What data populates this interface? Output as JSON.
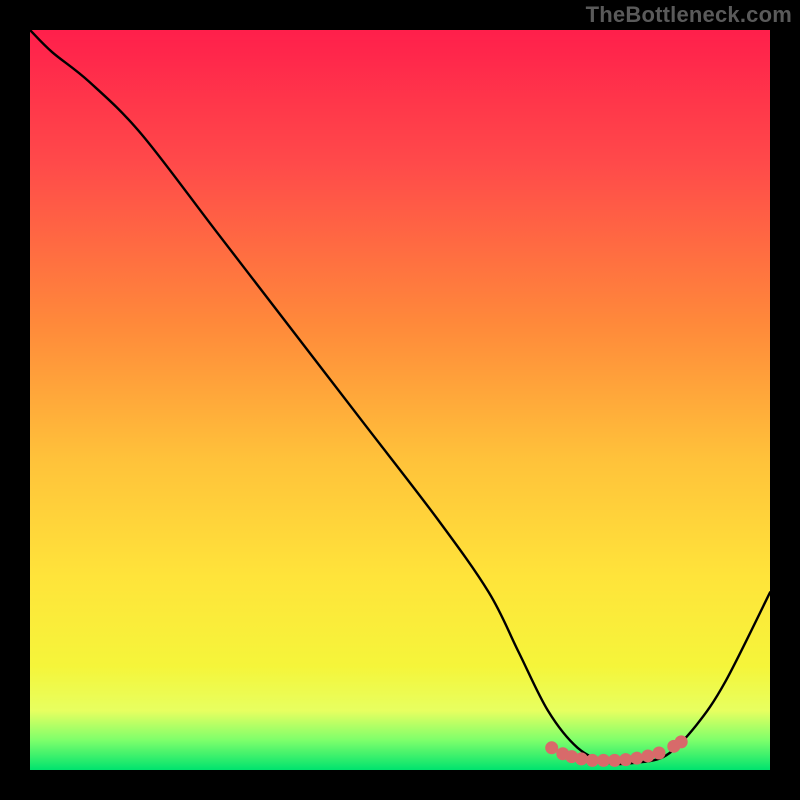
{
  "watermark": "TheBottleneck.com",
  "chart_data": {
    "type": "line",
    "title": "",
    "xlabel": "",
    "ylabel": "",
    "xlim": [
      0,
      100
    ],
    "ylim": [
      0,
      100
    ],
    "grid": false,
    "legend": false,
    "gradient_stops": [
      {
        "offset": 0,
        "color": "#ff1f4b"
      },
      {
        "offset": 18,
        "color": "#ff4a4a"
      },
      {
        "offset": 40,
        "color": "#ff8a3a"
      },
      {
        "offset": 58,
        "color": "#ffc23a"
      },
      {
        "offset": 74,
        "color": "#ffe43a"
      },
      {
        "offset": 86,
        "color": "#f5f53a"
      },
      {
        "offset": 92,
        "color": "#e7ff60"
      },
      {
        "offset": 96,
        "color": "#7dff6b"
      },
      {
        "offset": 100,
        "color": "#00e36e"
      }
    ],
    "series": [
      {
        "name": "bottleneck-curve",
        "x": [
          0,
          3,
          8,
          15,
          25,
          35,
          45,
          55,
          62,
          66,
          70,
          74,
          78,
          82,
          86,
          90,
          94,
          100
        ],
        "y": [
          100,
          97,
          93,
          86,
          73,
          60,
          47,
          34,
          24,
          16,
          8,
          3,
          1,
          1,
          2,
          6,
          12,
          24
        ]
      }
    ],
    "markers": {
      "name": "highlight-dots",
      "color": "#d86a6a",
      "points": [
        {
          "x": 70.5,
          "y": 3.0
        },
        {
          "x": 72.0,
          "y": 2.2
        },
        {
          "x": 73.2,
          "y": 1.8
        },
        {
          "x": 74.5,
          "y": 1.5
        },
        {
          "x": 76.0,
          "y": 1.3
        },
        {
          "x": 77.5,
          "y": 1.3
        },
        {
          "x": 79.0,
          "y": 1.3
        },
        {
          "x": 80.5,
          "y": 1.4
        },
        {
          "x": 82.0,
          "y": 1.6
        },
        {
          "x": 83.5,
          "y": 1.9
        },
        {
          "x": 85.0,
          "y": 2.3
        },
        {
          "x": 87.0,
          "y": 3.2
        },
        {
          "x": 88.0,
          "y": 3.8
        }
      ]
    }
  }
}
